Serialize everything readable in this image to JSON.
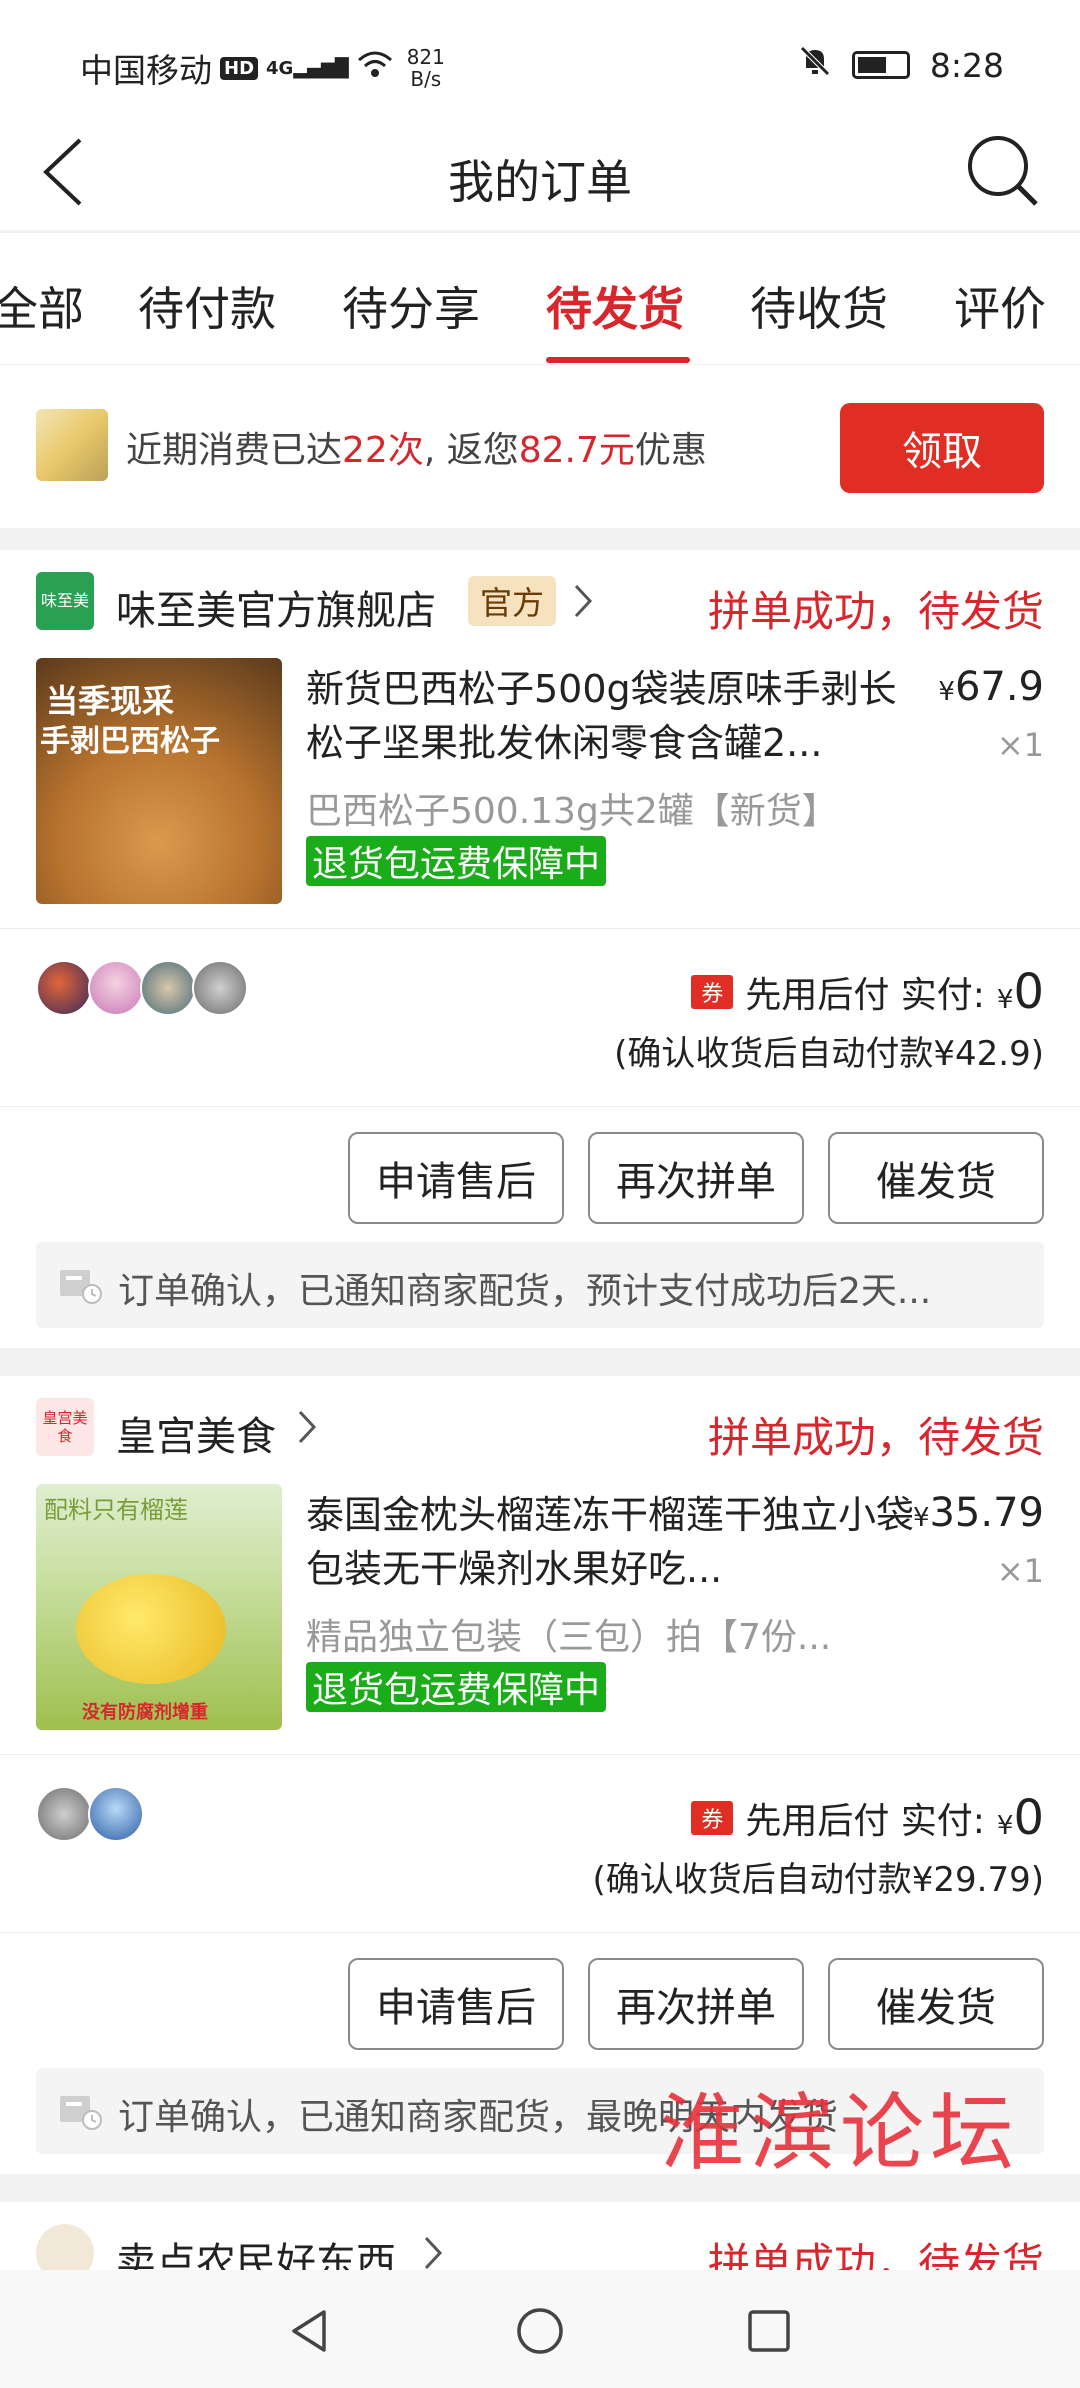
{
  "status_bar": {
    "carrier": "中国移动",
    "hd": "HD",
    "signal": "4G",
    "speed_value": "821",
    "speed_unit": "B/s",
    "time": "8:28"
  },
  "header": {
    "title": "我的订单"
  },
  "tabs": [
    {
      "label": "全部"
    },
    {
      "label": "待付款"
    },
    {
      "label": "待分享"
    },
    {
      "label": "待发货"
    },
    {
      "label": "待收货"
    },
    {
      "label": "评价"
    }
  ],
  "active_tab": "待发货",
  "promo": {
    "text_a": "近期消费已达",
    "count": "22次",
    "text_b": ", 返您",
    "amount": "82.7元",
    "text_c": "优惠",
    "button": "领取"
  },
  "orders": [
    {
      "shop_logo_text": "味至美",
      "shop_name": "味至美官方旗舰店",
      "badge": "官方",
      "status": "拼单成功，待发货",
      "product_title": "新货巴西松子500g袋装原味手剥长松子坚果批发休闲零食含罐2...",
      "currency": "¥",
      "price": "67.9",
      "qty": "×1",
      "spec": "巴西松子500.13g共2罐【新货】",
      "guarantee": "退货包运费保障中",
      "image_text_1": "当季现采",
      "image_text_2": "手剥巴西松子",
      "coupon": "券",
      "pay_label": "先用后付 实付:",
      "pay_currency": "¥",
      "pay_amount": "0",
      "autopay": "(确认收货后自动付款¥42.9)",
      "buttons": [
        "申请售后",
        "再次拼单",
        "催发货"
      ],
      "notice": "订单确认，已通知商家配货，预计支付成功后2天..."
    },
    {
      "shop_logo_text": "皇宫美食",
      "shop_name": "皇宫美食",
      "status": "拼单成功，待发货",
      "product_title": "泰国金枕头榴莲冻干榴莲干独立小袋包装无干燥剂水果好吃...",
      "currency": "¥",
      "price": "35.79",
      "qty": "×1",
      "spec": "精品独立包装（三包）拍【7份...",
      "guarantee": "退货包运费保障中",
      "image_text_1": "配料只有榴莲",
      "image_text_2": "没有防腐剂增重",
      "coupon": "券",
      "pay_label": "先用后付 实付:",
      "pay_currency": "¥",
      "pay_amount": "0",
      "autopay": "(确认收货后自动付款¥29.79)",
      "buttons": [
        "申请售后",
        "再次拼单",
        "催发货"
      ],
      "notice": "订单确认，已通知商家配货，最晚明天内发货"
    },
    {
      "shop_name": "卖点农民好东西",
      "status": "拼单成功，待发货"
    }
  ],
  "watermark": "淮滨论坛",
  "colors": {
    "accent": "#d7262c",
    "button_red": "#e02e24",
    "guarantee_green": "#1aac19",
    "official_badge": "#f7e2c0"
  }
}
